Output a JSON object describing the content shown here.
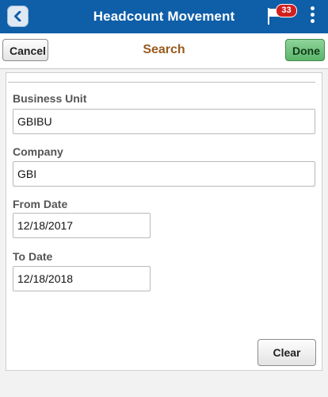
{
  "header": {
    "title": "Headcount Movement",
    "notification_count": "33"
  },
  "toolbar": {
    "cancel_label": "Cancel",
    "title": "Search",
    "done_label": "Done"
  },
  "form": {
    "fields": [
      {
        "label": "Business Unit",
        "value": "GBIBU"
      },
      {
        "label": "Company",
        "value": "GBI"
      },
      {
        "label": "From Date",
        "value": "12/18/2017"
      },
      {
        "label": "To Date",
        "value": "12/18/2018"
      }
    ],
    "clear_label": "Clear"
  },
  "colors": {
    "header_bg": "#0f5ea8",
    "toolbar_title": "#9a5a1e",
    "done_bg": "#5bb56a",
    "badge_bg": "#d41f1f"
  }
}
